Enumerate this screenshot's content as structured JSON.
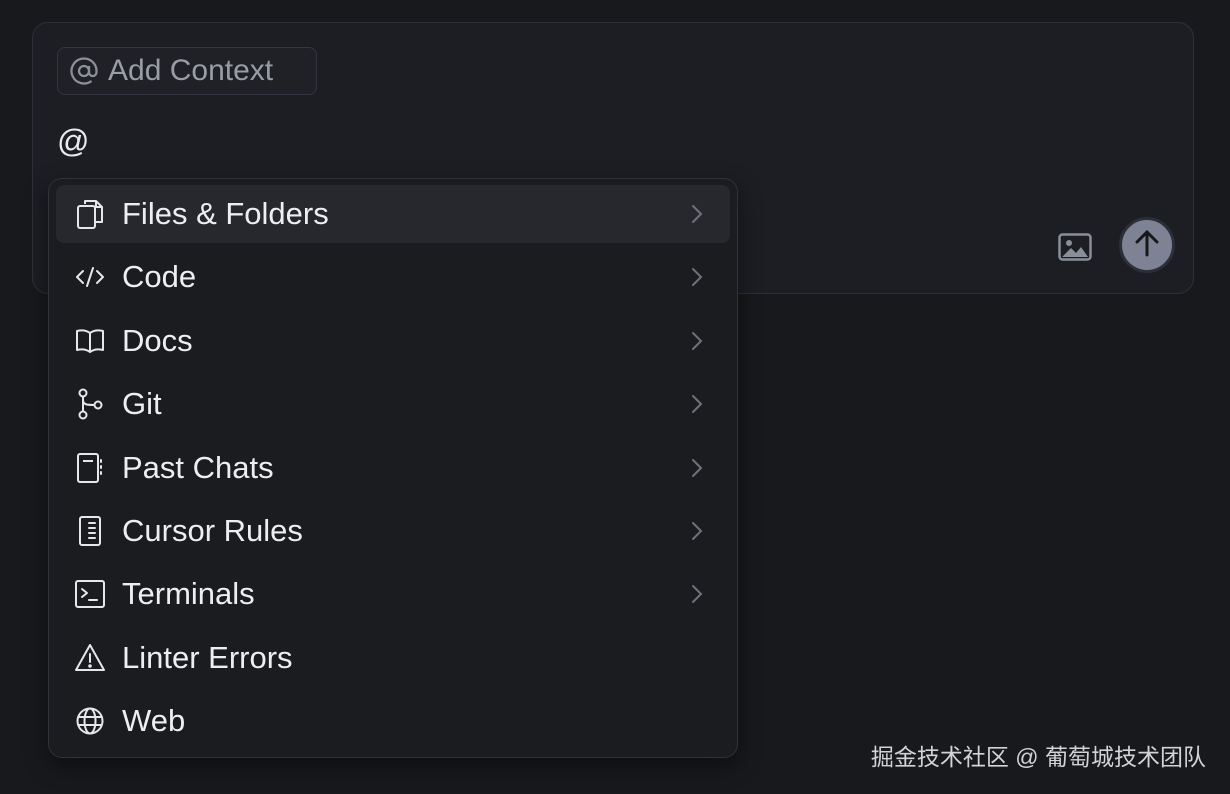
{
  "context_pill": {
    "icon": "at-sign-icon",
    "label": "Add Context"
  },
  "input": {
    "typed_text": "@"
  },
  "toolbar": {
    "image_icon": "image-icon",
    "send_icon": "arrow-up-icon"
  },
  "menu": {
    "items": [
      {
        "label": "Files & Folders",
        "icon": "files-icon",
        "has_submenu": true,
        "active": true
      },
      {
        "label": "Code",
        "icon": "code-icon",
        "has_submenu": true
      },
      {
        "label": "Docs",
        "icon": "book-icon",
        "has_submenu": true
      },
      {
        "label": "Git",
        "icon": "git-branch-icon",
        "has_submenu": true
      },
      {
        "label": "Past Chats",
        "icon": "notebook-icon",
        "has_submenu": true
      },
      {
        "label": "Cursor Rules",
        "icon": "rules-icon",
        "has_submenu": true
      },
      {
        "label": "Terminals",
        "icon": "terminal-icon",
        "has_submenu": true
      },
      {
        "label": "Linter Errors",
        "icon": "warning-icon",
        "has_submenu": false
      },
      {
        "label": "Web",
        "icon": "globe-icon",
        "has_submenu": false
      }
    ]
  },
  "watermark": "掘金技术社区 @ 葡萄城技术团队",
  "colors": {
    "background": "#18191c",
    "panel": "#1c1e24",
    "menu": "#1b1c20",
    "send_button": "#7d8394"
  }
}
